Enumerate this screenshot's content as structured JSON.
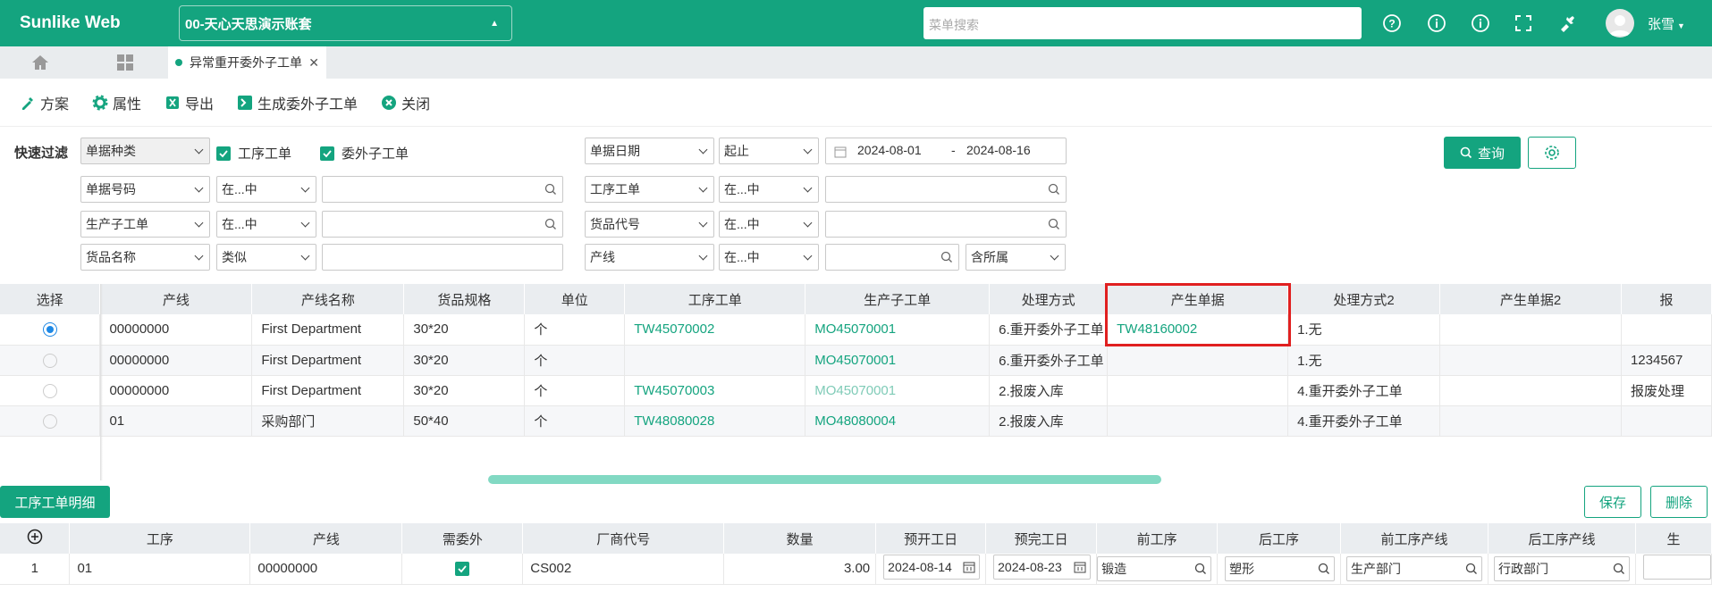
{
  "header": {
    "brand": "Sunlike Web",
    "account": "00-天心天思演示账套",
    "menu_search_placeholder": "菜单搜索",
    "user": "张雪"
  },
  "tabs": {
    "active": "异常重开委外子工单"
  },
  "toolbar": {
    "scheme": "方案",
    "props": "属性",
    "export": "导出",
    "generate": "生成委外子工单",
    "close": "关闭"
  },
  "filter": {
    "quick_label": "快速过滤",
    "doc_type": "单据种类",
    "chk1": "工序工单",
    "chk2": "委外子工单",
    "date_field": "单据日期",
    "date_op": "起止",
    "date_from": "2024-08-01",
    "date_sep": "-",
    "date_to": "2024-08-16",
    "r2_field1": "单据号码",
    "r2_op1": "在...中",
    "r2_field2": "工序工单",
    "r2_op2": "在...中",
    "r3_field1": "生产子工单",
    "r3_op1": "在...中",
    "r3_field2": "货品代号",
    "r3_op2": "在...中",
    "r4_field1": "货品名称",
    "r4_op1": "类似",
    "r4_field2": "产线",
    "r4_op2": "在...中",
    "r4_extra": "含所属",
    "query": "查询"
  },
  "grid": {
    "headers": [
      "选择",
      "产线",
      "产线名称",
      "货品规格",
      "单位",
      "工序工单",
      "生产子工单",
      "处理方式",
      "产生单据",
      "处理方式2",
      "产生单据2",
      "报"
    ],
    "rows": [
      {
        "line": "00000000",
        "line_name": "First Department",
        "spec": "30*20",
        "unit": "个",
        "proc": "TW45070002",
        "mo": "MO45070001",
        "method": "6.重开委外子工单",
        "doc": "TW48160002",
        "method2": "1.无",
        "doc2": "",
        "extra": ""
      },
      {
        "line": "00000000",
        "line_name": "First Department",
        "spec": "30*20",
        "unit": "个",
        "proc": "",
        "mo": "MO45070001",
        "method": "6.重开委外子工单",
        "doc": "",
        "method2": "1.无",
        "doc2": "",
        "extra": "1234567"
      },
      {
        "line": "00000000",
        "line_name": "First Department",
        "spec": "30*20",
        "unit": "个",
        "proc": "TW45070003",
        "mo": "MO45070001",
        "method": "2.报废入库",
        "doc": "",
        "method2": "4.重开委外子工单",
        "doc2": "",
        "extra": "报废处理"
      },
      {
        "line": "01",
        "line_name": "采购部门",
        "spec": "50*40",
        "unit": "个",
        "proc": "TW48080028",
        "mo": "MO48080004",
        "method": "2.报废入库",
        "doc": "",
        "method2": "4.重开委外子工单",
        "doc2": "",
        "extra": ""
      }
    ]
  },
  "detail": {
    "tab": "工序工单明细",
    "save": "保存",
    "delete": "删除",
    "headers": [
      "工序",
      "产线",
      "需委外",
      "厂商代号",
      "数量",
      "预开工日",
      "预完工日",
      "前工序",
      "后工序",
      "前工序产线",
      "后工序产线",
      "生"
    ],
    "row": {
      "idx": "1",
      "proc": "01",
      "line": "00000000",
      "vendor": "CS002",
      "qty": "3.00",
      "start": "2024-08-14",
      "end": "2024-08-23",
      "prev": "锻造",
      "next": "塑形",
      "prev_line": "生产部门",
      "next_line": "行政部门"
    }
  },
  "colors": {
    "accent": "#14a47f",
    "highlight": "#e02020"
  }
}
